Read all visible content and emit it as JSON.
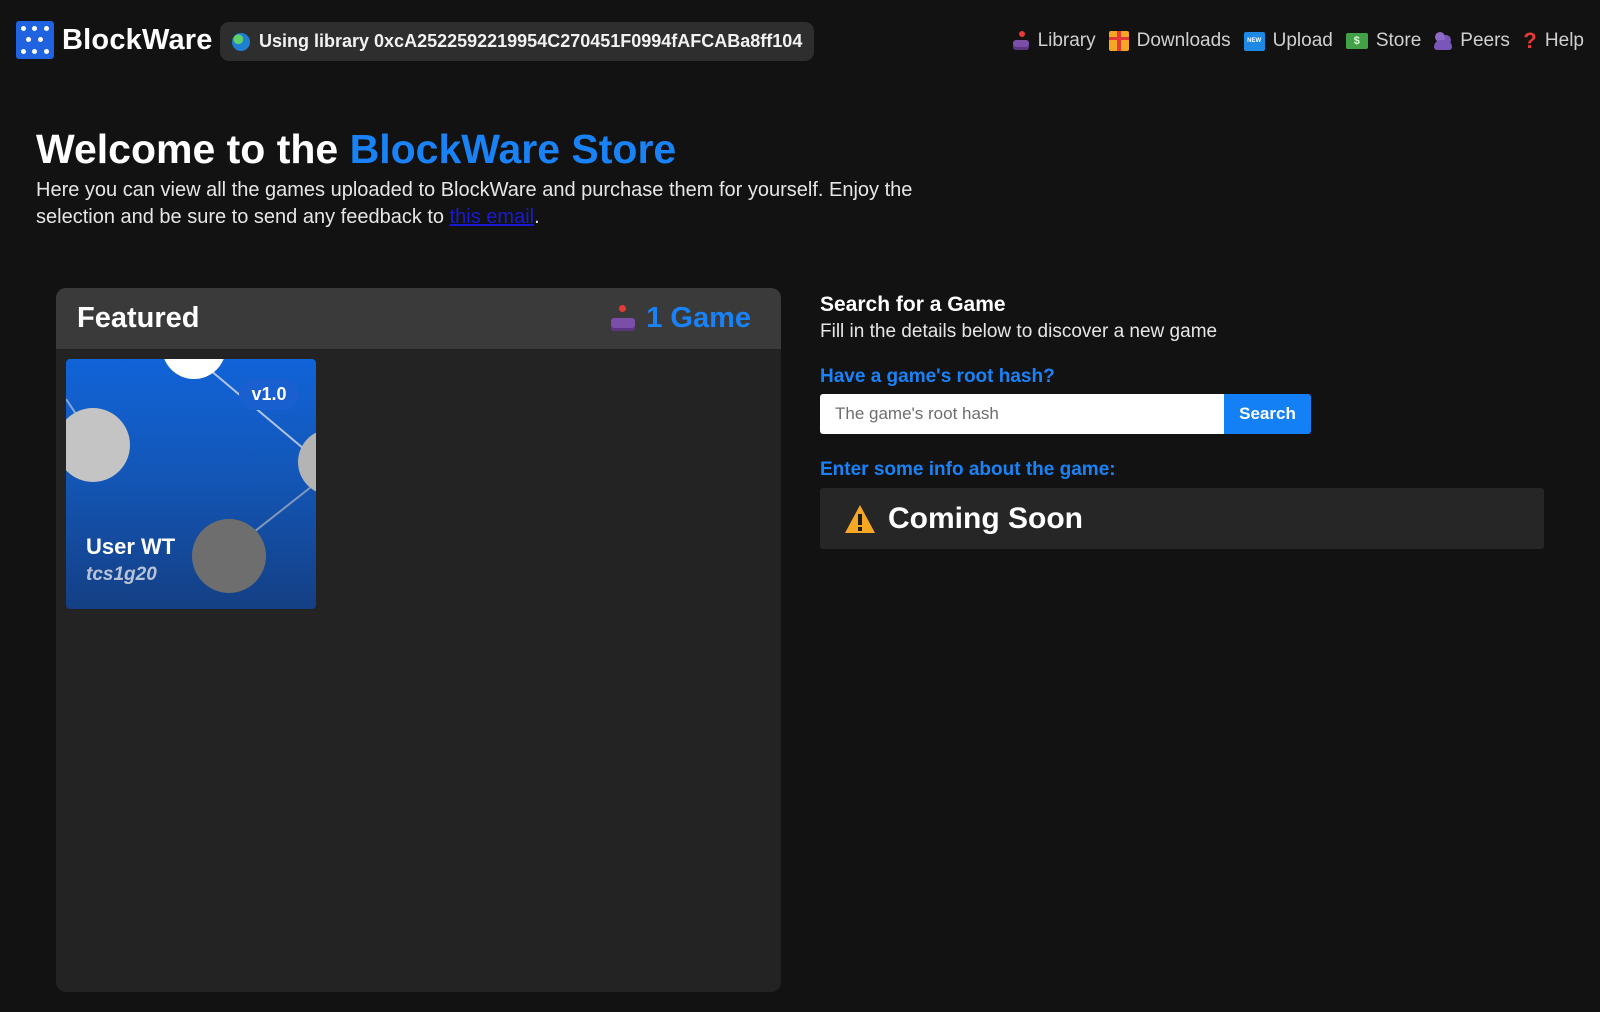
{
  "brand": {
    "name": "BlockWare",
    "icon": "dice-icon",
    "color": "#1f63e0"
  },
  "library": {
    "text": "Using library 0xcA2522592219954C270451F0994fAFCABa8ff104",
    "icon": "globe-icon"
  },
  "nav": [
    {
      "label": "Library",
      "icon": "joystick-icon"
    },
    {
      "label": "Downloads",
      "icon": "gift-icon"
    },
    {
      "label": "Upload",
      "icon": "new-icon"
    },
    {
      "label": "Store",
      "icon": "money-icon"
    },
    {
      "label": "Peers",
      "icon": "peers-icon"
    },
    {
      "label": "Help",
      "icon": "question-icon"
    }
  ],
  "hero": {
    "title_prefix": "Welcome to the ",
    "title_accent": "BlockWare Store",
    "intro_before": "Here you can view all the games uploaded to BlockWare and purchase them for yourself. Enjoy the selection and be sure to send any feedback to ",
    "intro_link": "this email",
    "intro_after": "."
  },
  "featured": {
    "title": "Featured",
    "count_label": "1 Game",
    "games": [
      {
        "title": "User WT",
        "author": "tcs1g20",
        "version": "v1.0"
      }
    ]
  },
  "search": {
    "title": "Search for a Game",
    "subtitle": "Fill in the details below to discover a new game",
    "hash_label": "Have a game's root hash?",
    "placeholder": "The game's root hash",
    "button_label": "Search",
    "info_label": "Enter some info about the game:",
    "coming_soon": "Coming Soon"
  },
  "colors": {
    "accent": "#1a82f7",
    "background": "#121212",
    "panel": "#232323",
    "button": "#1480f5"
  }
}
